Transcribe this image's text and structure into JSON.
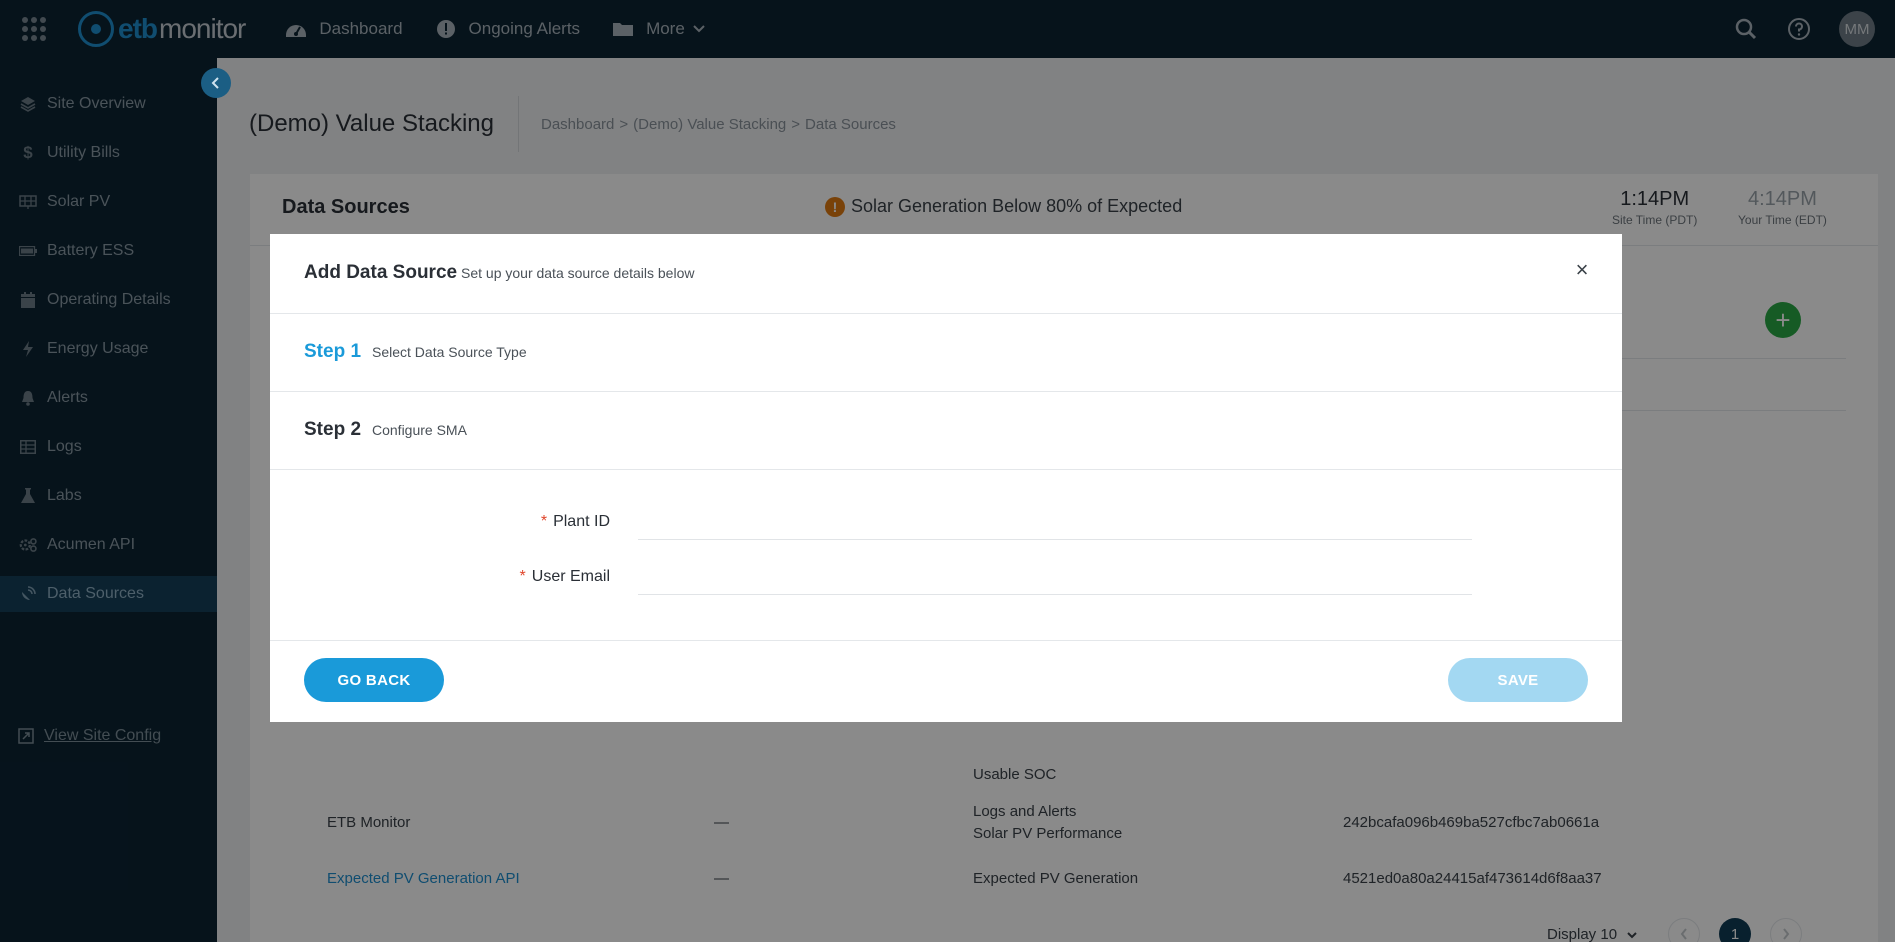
{
  "topbar": {
    "logo_etb": "etb",
    "logo_monitor": "monitor",
    "nav": [
      {
        "label": "Dashboard",
        "icon": "gauge-icon"
      },
      {
        "label": "Ongoing Alerts",
        "icon": "alert-circle-icon"
      },
      {
        "label": "More",
        "icon": "folder-icon"
      }
    ],
    "avatar_initials": "MM"
  },
  "sidebar": {
    "items": [
      {
        "label": "Site Overview",
        "icon": "layers-icon"
      },
      {
        "label": "Utility Bills",
        "icon": "dollar-icon"
      },
      {
        "label": "Solar PV",
        "icon": "solar-panel-icon"
      },
      {
        "label": "Battery ESS",
        "icon": "battery-icon"
      },
      {
        "label": "Operating Details",
        "icon": "calendar-icon"
      },
      {
        "label": "Energy Usage",
        "icon": "bolt-icon"
      },
      {
        "label": "Alerts",
        "icon": "bell-icon"
      },
      {
        "label": "Logs",
        "icon": "table-icon"
      },
      {
        "label": "Labs",
        "icon": "flask-icon"
      },
      {
        "label": "Acumen API",
        "icon": "cogs-icon"
      },
      {
        "label": "Data Sources",
        "icon": "satellite-dish-icon"
      }
    ],
    "active_index": 10,
    "view_site_config": "View Site Config"
  },
  "page": {
    "title": "(Demo) Value Stacking",
    "breadcrumb": [
      "Dashboard",
      "(Demo) Value Stacking",
      "Data Sources"
    ],
    "breadcrumb_sep": ">"
  },
  "card": {
    "title": "Data Sources",
    "alert_text": "Solar Generation Below 80% of Expected",
    "alert_mark": "!",
    "site_time": "1:14PM",
    "site_time_label": "Site Time (PDT)",
    "your_time": "4:14PM",
    "your_time_label": "Your Time (EDT)"
  },
  "table": {
    "partial_cell": "Usable SOC",
    "rows": [
      {
        "name": "ETB Monitor",
        "dash": "—",
        "uses": [
          "Logs and Alerts",
          "Solar PV Performance"
        ],
        "id": "242bcafa096b469ba527cfbc7ab0661a",
        "link": false
      },
      {
        "name": "Expected PV Generation API",
        "dash": "—",
        "uses": [
          "Expected PV Generation"
        ],
        "id": "4521ed0a80a24415af473614d6f8aa37",
        "link": true
      }
    ]
  },
  "pagination": {
    "display_label": "Display 10",
    "current_page": "1"
  },
  "modal": {
    "title": "Add Data Source",
    "subtitle": "Set up your data source details below",
    "close": "×",
    "step1_num": "Step 1",
    "step1_desc": "Select Data Source Type",
    "step2_num": "Step 2",
    "step2_desc": "Configure SMA",
    "fields": [
      {
        "label": "Plant ID",
        "required_mark": "*",
        "value": ""
      },
      {
        "label": "User Email",
        "required_mark": "*",
        "value": ""
      }
    ],
    "back_label": "GO BACK",
    "save_label": "SAVE"
  },
  "colors": {
    "accent": "#1a9ad9",
    "topbar": "#0c2433",
    "alert_orange": "#e07b12",
    "add_green": "#2aa845"
  }
}
